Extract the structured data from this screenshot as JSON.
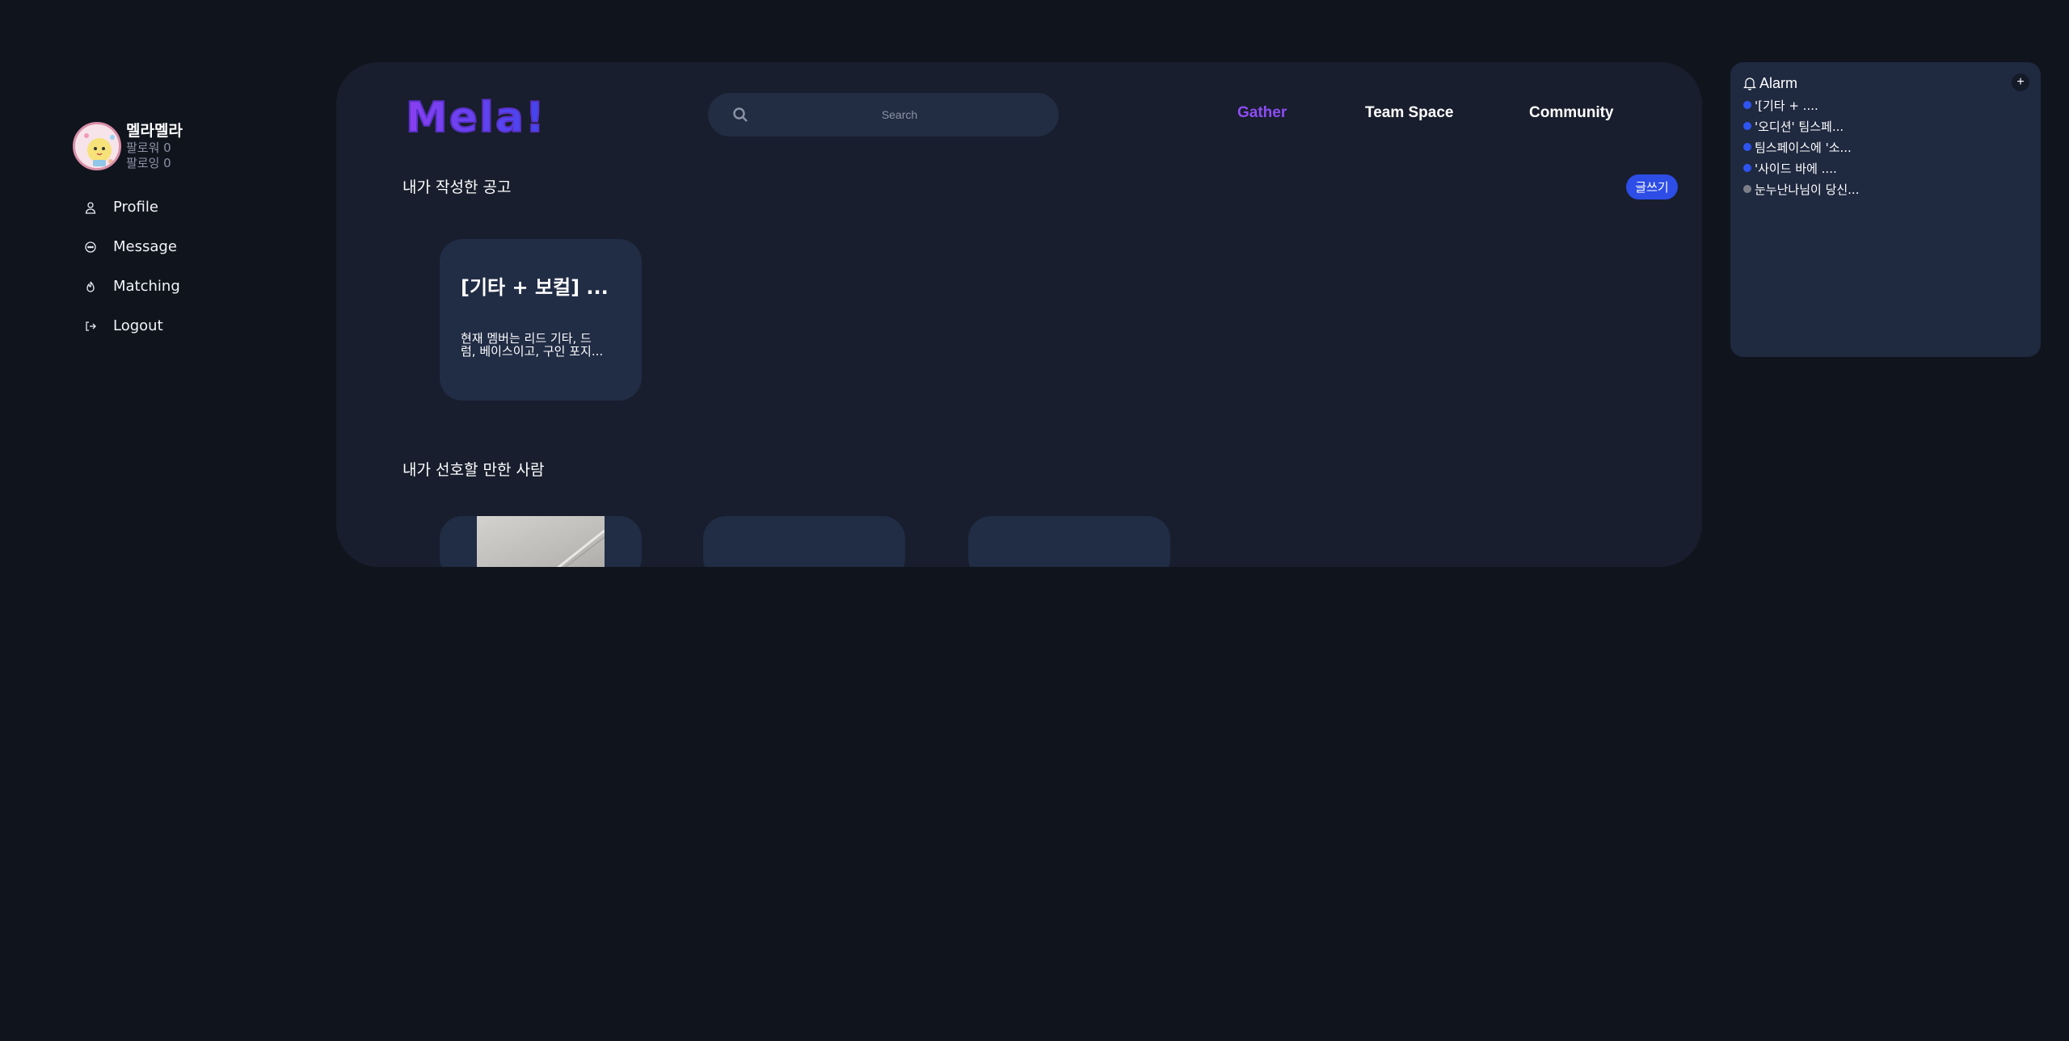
{
  "user": {
    "name": "멜라멜라",
    "followers": "팔로워 0",
    "following": "팔로잉 0"
  },
  "sidebar": {
    "items": [
      {
        "label": "Profile",
        "icon": "user-icon"
      },
      {
        "label": "Message",
        "icon": "message-icon"
      },
      {
        "label": "Matching",
        "icon": "flame-icon"
      },
      {
        "label": "Logout",
        "icon": "logout-icon"
      }
    ]
  },
  "header": {
    "logo_text": "Mela!",
    "search_placeholder": "Search",
    "nav": {
      "gather": "Gather",
      "team_space": "Team Space",
      "community": "Community"
    },
    "active_nav": "Gather",
    "active_color": "#8d4cf5"
  },
  "sections": {
    "my_posts": "내가 작성한 공고",
    "write_button": "글쓰기",
    "recommended": "내가 선호할 만한 사람"
  },
  "posts": [
    {
      "title": "[기타 + 보컬] ...",
      "body_line1": "현재 멤버는 리드 기타, 드",
      "body_line2": "럼, 베이스이고, 구인 포지..."
    }
  ],
  "alarm": {
    "title": "Alarm",
    "add_label": "+",
    "items": [
      {
        "text": "'[기타 + ....",
        "color": "#2f55f0"
      },
      {
        "text": "'오디션' 팀스페...",
        "color": "#2f55f0"
      },
      {
        "text": "팀스페이스에 '소...",
        "color": "#2f55f0"
      },
      {
        "text": "'사이드 바에 ....",
        "color": "#2f55f0"
      },
      {
        "text": "눈누난나님이 당신...",
        "color": "#7c7f88"
      }
    ]
  },
  "colors": {
    "background": "#10141d",
    "panel": "#181e2d",
    "card": "#212c45",
    "accent": "#2d4de6"
  }
}
